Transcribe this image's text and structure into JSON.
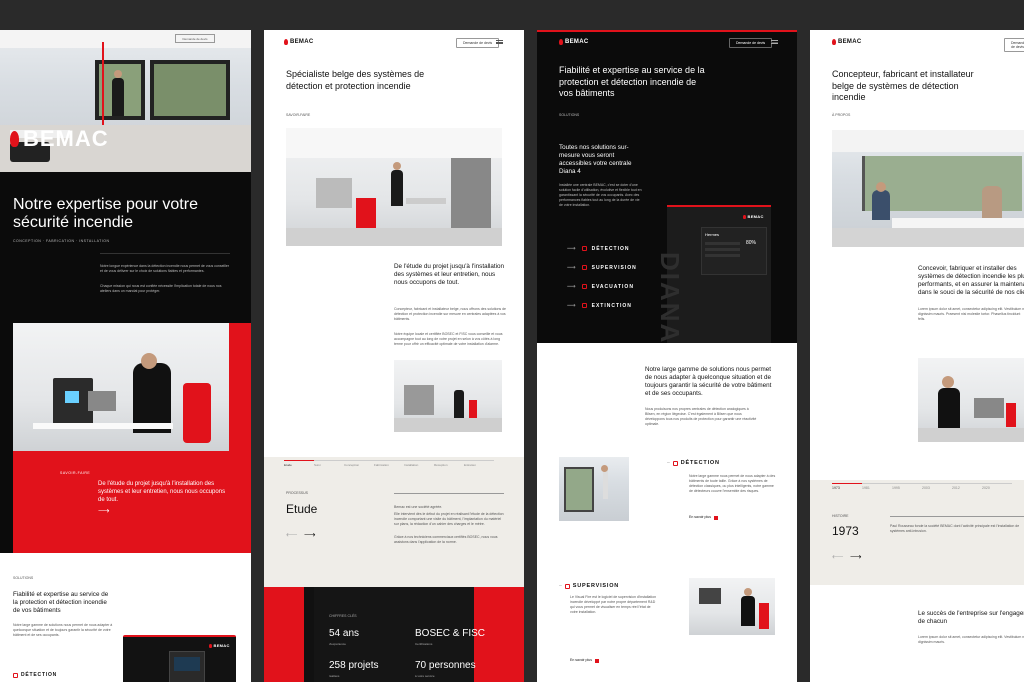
{
  "brand": {
    "name": "BEMAC",
    "accent": "#e1121b",
    "dark": "#0b0b0b"
  },
  "header": {
    "contact_label": "Demande de devis"
  },
  "panel1": {
    "hero_title": "Notre expertise pour votre sécurité incendie",
    "hero_tags": "CONCEPTION · FABRICATION · INSTALLATION",
    "intro_1": "Notre longue expérience dans la détection incendie nous permet de vous conseiller et de vous délivrer sur le choix de solutions fiables et performantes.",
    "intro_2": "Chaque mission qui nous est confiée nécessite l'implication totale de nous nos ateliers dans un mandat pour protéger.",
    "red_caption_label": "SAVOIR-FAIRE",
    "red_caption": "De l'étude du projet jusqu'à l'installation des systèmes et leur entretien, nous nous occupons de tout.",
    "solutions_label": "SOLUTIONS",
    "solutions_title": "Fiabilité et expertise au service de la protection et détection incendie de vos bâtiments",
    "solutions_text": "Notre large gamme de solutions nous permet de nous adapter à quelconque situation et de toujours garantir la sécurité de votre bâtiment et de ses occupants.",
    "detection_label": "DÉTECTION"
  },
  "panel2": {
    "title": "Spécialiste belge des systèmes de détection et protection incendie",
    "tag": "SAVOIR-FAIRE",
    "block_title": "De l'étude du projet jusqu'à l'installation des systèmes et leur entretien, nous nous occupons de tout.",
    "block_text_1": "Concepteur, fabricant et installateur belge, nous offrons des solutions de détection et protection incendie sur mesure en centrales adaptées à vos bâtiments.",
    "block_text_2": "Notre équipe locale et certifiée BOSEC et FISC vous conseille et vous accompagne tout au long de votre projet en selon à vos côtés à long terme pour offrir un efficacité optimale de votre installation d'alarme.",
    "tabs": [
      "Etude",
      "Suivi",
      "Conception",
      "Fabrication",
      "Installation",
      "Réception",
      "Entretien"
    ],
    "process_label": "PROCESSUS",
    "process_title": "Etude",
    "process_text_1": "Bemac est une société agréée.",
    "process_text_2": "Elle intervient dès le début du projet en réalisant l'étude de la détection incendie comportant une visite du bâtiment, l'implantation du matériel sur plans, la rédaction d'un cahier des charges et le mètre.",
    "process_text_3": "Grâce à nos techniciens commerciaux certifiés BOSEC, nous vous assistons dans l'application de la norme.",
    "stats_label": "CHIFFRES CLÉS",
    "stats": [
      {
        "value": "54 ans",
        "label": "d'expérience"
      },
      {
        "value": "BOSEC & FISC",
        "label": "Certifications"
      },
      {
        "value": "258 projets",
        "label": "réalisés"
      },
      {
        "value": "70 personnes",
        "label": "à votre service"
      }
    ]
  },
  "panel3": {
    "title": "Fiabilité et expertise au service de la protection et détection incendie de vos bâtiments",
    "tag": "SOLUTIONS",
    "diana_title": "Toutes nos solutions sur-mesure vous seront accessibles votre centrale Diana 4",
    "diana_text": "Installée une centrale BEMAC, c'est se doter d'une solution facile d'utilisation, évolutive et flexible tout en garantissant la sécurité de vos occupants. Avec des performances fiables tout au long de la durée de vie de votre installation.",
    "device_brand": "BEMAC",
    "device_screen_text": "Hermes",
    "device_percent": "80%",
    "diana_vertical": "DIANA 4",
    "menu": [
      "DÉTECTION",
      "SUPERVISION",
      "EVACUATION",
      "EXTINCTION"
    ],
    "range_title": "Notre large gamme de solutions nous permet de nous adapter à quelconque situation et de toujours garantir la sécurité de votre bâtiment et de ses occupants.",
    "range_text": "Nous produisons nos propres centrales de détection analogiques à Bilsen, en région liégeoise. C'est également à Bilsen que nous développons tous nos produits de protection pour garantir une réactivité optimale.",
    "detection_label": "DÉTECTION",
    "detection_text": "Notre large gamme nous permet de nous adapter à des bâtiments de toute taille. Grâce à nos systèmes de détection classiques, ou plus intelligents, notre gamme de détecteurs couvre l'ensemble des risques.",
    "supervision_label": "SUPERVISION",
    "supervision_text": "Le Visual Fire est le logiciel de supervision d'installation incendie développé par notre propre département R&D qui vous permet de visualiser en temps réel l'état de votre installation.",
    "more_label": "En savoir plus"
  },
  "panel4": {
    "title": "Concepteur, fabricant et installateur belge de systèmes de détection incendie",
    "tag": "À PROPOS",
    "intro_title": "Concevoir, fabriquer et installer des systèmes de détection incendie les plus performants, et en assurer la maintenance dans le souci de la sécurité de nos clients",
    "intro_text": "Lorem ipsum dolor sit amet, consectetur adipiscing elit. Vestibulum nisi dignissim mauris. Praesent nisi molestie tortor. Phasellus tincidunt felis.",
    "history_years": [
      "1973",
      "1981",
      "1995",
      "2003",
      "2012",
      "2020"
    ],
    "history_label": "HISTOIRE",
    "history_year": "1973",
    "history_text": "Paul Rousseau fonde la société BEMAC dont l'activité principale est l'installation de systèmes anti-intrusion.",
    "engage_title": "Le succès de l'entreprise sur l'engagement de chacun",
    "engage_text": "Lorem ipsum dolor sit amet, consectetur adipiscing elit. Vestibulum nisi dignissim mauris."
  }
}
